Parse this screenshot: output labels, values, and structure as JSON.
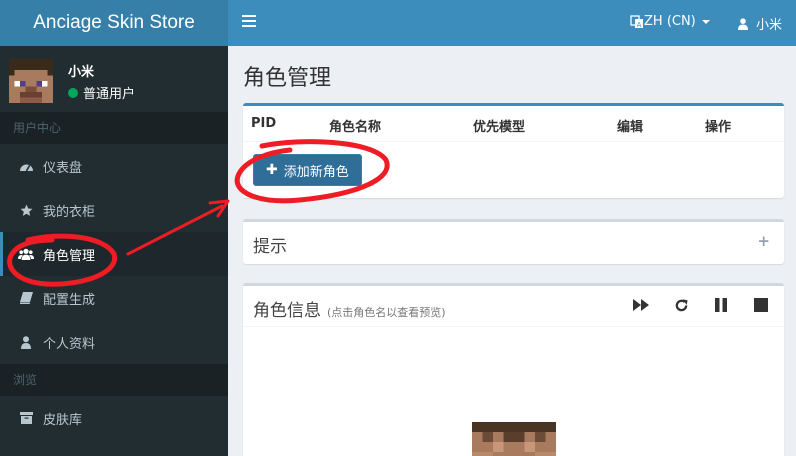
{
  "brand": {
    "name": "Anciage Skin Store"
  },
  "topbar": {
    "language": "ZH (CN)",
    "username": "小米"
  },
  "user_panel": {
    "name": "小米",
    "status": "普通用户"
  },
  "sidebar": {
    "section_user": "用户中心",
    "items": [
      {
        "label": "仪表盘",
        "icon": "dashboard-icon"
      },
      {
        "label": "我的衣柜",
        "icon": "star-icon"
      },
      {
        "label": "角色管理",
        "icon": "users-icon"
      },
      {
        "label": "配置生成",
        "icon": "book-icon"
      },
      {
        "label": "个人资料",
        "icon": "user-icon"
      }
    ],
    "section_browse": "浏览",
    "browse_items": [
      {
        "label": "皮肤库",
        "icon": "archive-icon"
      }
    ]
  },
  "page": {
    "title": "角色管理"
  },
  "players_table": {
    "headers": [
      "PID",
      "角色名称",
      "优先模型",
      "编辑",
      "操作"
    ],
    "add_button": "添加新角色"
  },
  "tips_box": {
    "title": "提示"
  },
  "preview_box": {
    "title": "角色信息",
    "subtitle": "(点击角色名以查看预览)"
  },
  "colors": {
    "accent": "#3c8dbc",
    "sidebar_bg": "#222d32",
    "annotation": "#ee1c25"
  }
}
